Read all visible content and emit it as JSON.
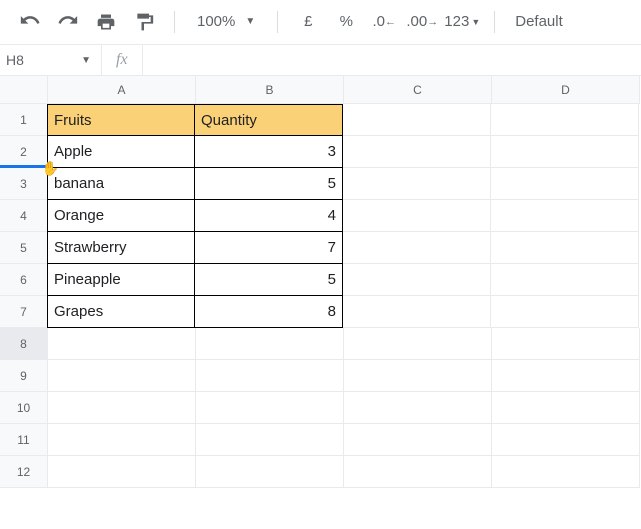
{
  "toolbar": {
    "zoom": "100%",
    "currency": "£",
    "percent": "%",
    "dec_dec": ".0",
    "dec_inc": ".00",
    "more_fmt": "123",
    "font": "Default"
  },
  "namebox": {
    "ref": "H8"
  },
  "fx": {
    "label": "fx",
    "value": ""
  },
  "cols": [
    "A",
    "B",
    "C",
    "D"
  ],
  "rows": [
    "1",
    "2",
    "3",
    "4",
    "5",
    "6",
    "7",
    "8",
    "9",
    "10",
    "11",
    "12"
  ],
  "selected_row": "8",
  "hover_row": "2",
  "chart_data": {
    "type": "table",
    "headers": [
      "Fruits",
      "Quantity"
    ],
    "data": [
      [
        "Apple",
        3
      ],
      [
        "banana",
        5
      ],
      [
        "Orange",
        4
      ],
      [
        "Strawberry",
        7
      ],
      [
        "Pineapple",
        5
      ],
      [
        "Grapes",
        8
      ]
    ]
  }
}
